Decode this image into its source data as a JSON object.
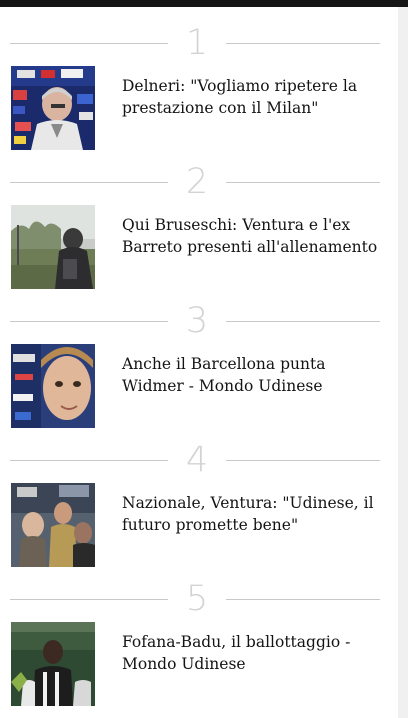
{
  "articles": [
    {
      "rank": "1",
      "title": "Delneri: \"Vogliamo ripetere la prestazione con il Milan\"",
      "thumbnail_subject": "coach interview in front of sponsor backdrop"
    },
    {
      "rank": "2",
      "title": "Qui Bruseschi: Ventura e l'ex Barreto presenti all'allenamento",
      "thumbnail_subject": "training ground with trees"
    },
    {
      "rank": "3",
      "title": "Anche il Barcellona punta Widmer - Mondo Udinese",
      "thumbnail_subject": "player portrait close-up"
    },
    {
      "rank": "4",
      "title": "Nazionale, Ventura: \"Udinese, il futuro promette bene\"",
      "thumbnail_subject": "people at press event"
    },
    {
      "rank": "5",
      "title": "Fofana-Badu, il ballottaggio - Mondo Udinese",
      "thumbnail_subject": "players in stadium"
    }
  ],
  "colors": {
    "top_bar": "#151515",
    "page_background": "#ffffff",
    "side_strip": "#f0f0f0",
    "divider_line": "#c8c8c8",
    "rank_number": "#d3d3d3",
    "headline_text": "#141414"
  }
}
